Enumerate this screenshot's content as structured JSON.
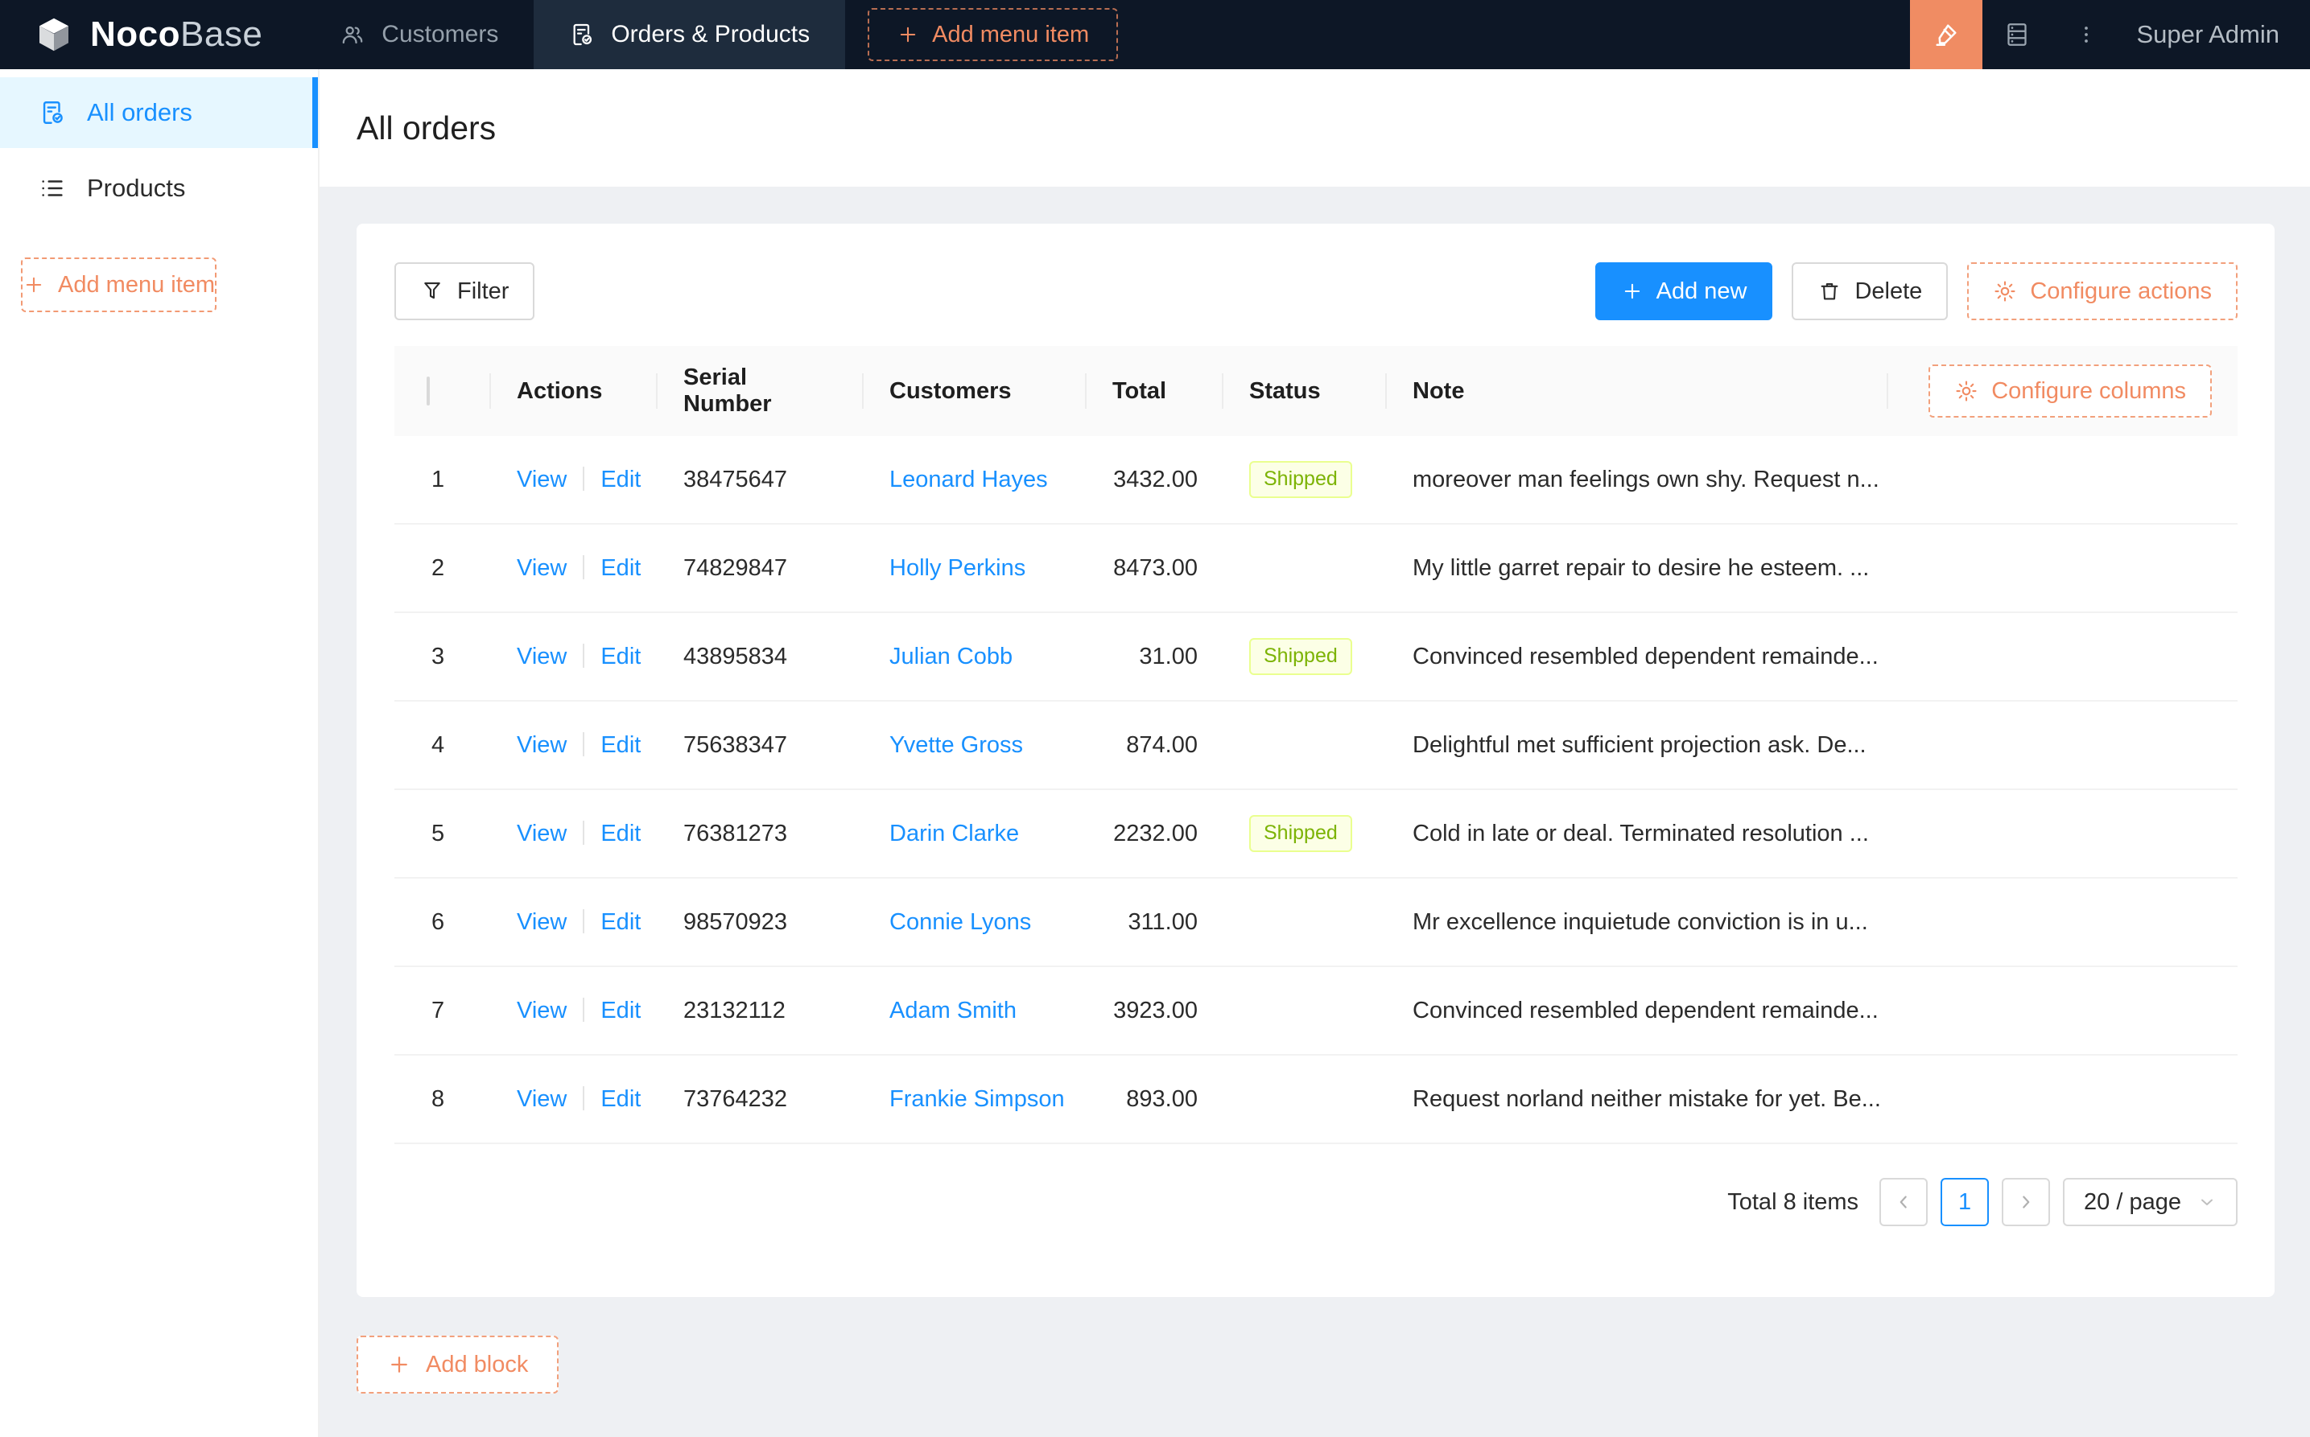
{
  "navbar": {
    "logo": {
      "noco": "Noco",
      "base": "Base"
    },
    "tabs": [
      {
        "label": "Customers",
        "active": false
      },
      {
        "label": "Orders & Products",
        "active": true
      }
    ],
    "add_menu_item_label": "Add menu item",
    "user_label": "Super Admin"
  },
  "sidebar": {
    "items": [
      {
        "label": "All orders",
        "active": true
      },
      {
        "label": "Products",
        "active": false
      }
    ],
    "add_menu_item_label": "Add menu item"
  },
  "page": {
    "title": "All orders"
  },
  "toolbar": {
    "filter_label": "Filter",
    "add_new_label": "Add new",
    "delete_label": "Delete",
    "configure_actions_label": "Configure actions"
  },
  "table": {
    "configure_columns_label": "Configure columns",
    "columns": [
      "Actions",
      "Serial Number",
      "Customers",
      "Total",
      "Status",
      "Note"
    ],
    "action_labels": {
      "view": "View",
      "edit": "Edit"
    },
    "rows": [
      {
        "index": 1,
        "serial": "38475647",
        "customer": "Leonard Hayes",
        "total": "3432.00",
        "status": "Shipped",
        "note": "moreover man feelings own shy. Request n..."
      },
      {
        "index": 2,
        "serial": "74829847",
        "customer": "Holly Perkins",
        "total": "8473.00",
        "status": "",
        "note": "My little garret repair to desire he esteem. ..."
      },
      {
        "index": 3,
        "serial": "43895834",
        "customer": "Julian Cobb",
        "total": "31.00",
        "status": "Shipped",
        "note": "Convinced resembled dependent remainde..."
      },
      {
        "index": 4,
        "serial": "75638347",
        "customer": "Yvette Gross",
        "total": "874.00",
        "status": "",
        "note": "Delightful met sufficient projection ask. De..."
      },
      {
        "index": 5,
        "serial": "76381273",
        "customer": "Darin Clarke",
        "total": "2232.00",
        "status": "Shipped",
        "note": "Cold in late or deal. Terminated resolution ..."
      },
      {
        "index": 6,
        "serial": "98570923",
        "customer": "Connie Lyons",
        "total": "311.00",
        "status": "",
        "note": "Mr excellence inquietude conviction is in u..."
      },
      {
        "index": 7,
        "serial": "23132112",
        "customer": "Adam Smith",
        "total": "3923.00",
        "status": "",
        "note": "Convinced resembled dependent remainde..."
      },
      {
        "index": 8,
        "serial": "73764232",
        "customer": "Frankie Simpson",
        "total": "893.00",
        "status": "",
        "note": "Request norland neither mistake for yet. Be..."
      }
    ]
  },
  "pagination": {
    "total_text": "Total 8 items",
    "current_page": "1",
    "page_size_label": "20 / page"
  },
  "footer": {
    "add_block_label": "Add block"
  },
  "colors": {
    "navbar_bg": "#0d1726",
    "navbar_active_tab_bg": "#1e2c3d",
    "accent_orange": "#f18b62",
    "primary_blue": "#1890ff",
    "sidebar_selected_bg": "#e6f7ff",
    "status_tag_bg": "#fcffe6",
    "status_tag_border": "#eaff8f",
    "status_tag_text": "#7cb305"
  }
}
